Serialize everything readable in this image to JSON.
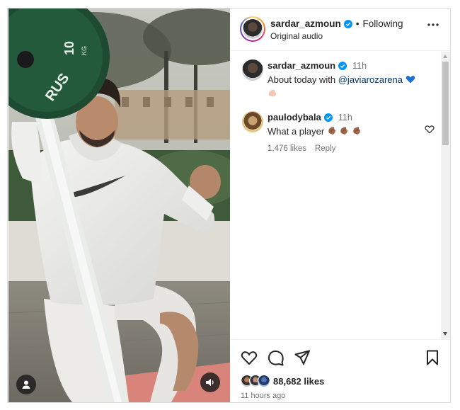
{
  "post": {
    "author": "sardar_azmoun",
    "dot": "•",
    "following_label": "Following",
    "audio_label": "Original audio",
    "likes": "88,682 likes",
    "posted_ago": "11 hours ago",
    "plate_text_top": "10",
    "plate_text_side": "RUS",
    "plate_unit": "KG"
  },
  "comments": [
    {
      "username": "sardar_azmoun",
      "time": "11h",
      "text_before": "About today with ",
      "mention": "@javiarozarena",
      "emoji_after": "blue-heart",
      "second_line_emoji": "flexed-biceps"
    },
    {
      "username": "paulodybala",
      "time": "11h",
      "text": "What a player",
      "emojis": [
        "clapping-hands",
        "clapping-hands",
        "clapping-hands"
      ],
      "likes": "1,476 likes",
      "reply_label": "Reply"
    }
  ],
  "icons": {
    "verified": "verified-badge-icon",
    "more": "more-options-icon",
    "like": "heart-icon",
    "comment": "comment-icon",
    "share": "share-icon",
    "save": "bookmark-icon",
    "user_tags": "user-icon",
    "audio": "speaker-icon"
  },
  "colors": {
    "verified_blue": "#0095f6",
    "mention_blue": "#00376b",
    "secondary_text": "#737373",
    "divider": "#efefef"
  }
}
